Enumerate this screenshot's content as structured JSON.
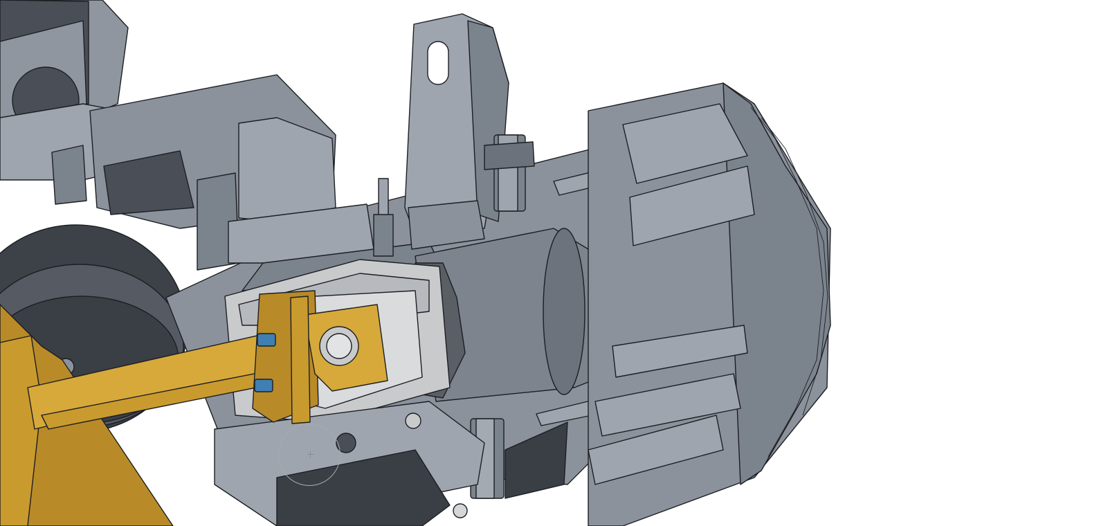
{
  "viewport": {
    "content": "section-view-3d-model",
    "background_color": "#ffffff"
  },
  "colors": {
    "body_gray": "#8b929c",
    "face_light": "#9ea5ae",
    "face_mid": "#7b838d",
    "face_dark": "#4a4f57",
    "cavity_dark": "#3a3e45",
    "piston_light": "#c8cacc",
    "brass": "#c99a2e",
    "brass_dark": "#a17520",
    "oring_blue": "#3f7fb3",
    "outline": "#1c1e22",
    "cursor_ring": "#a7abb1"
  },
  "cursor": {
    "type": "rotate-cursor",
    "icon": "rotate-circle-icon"
  }
}
